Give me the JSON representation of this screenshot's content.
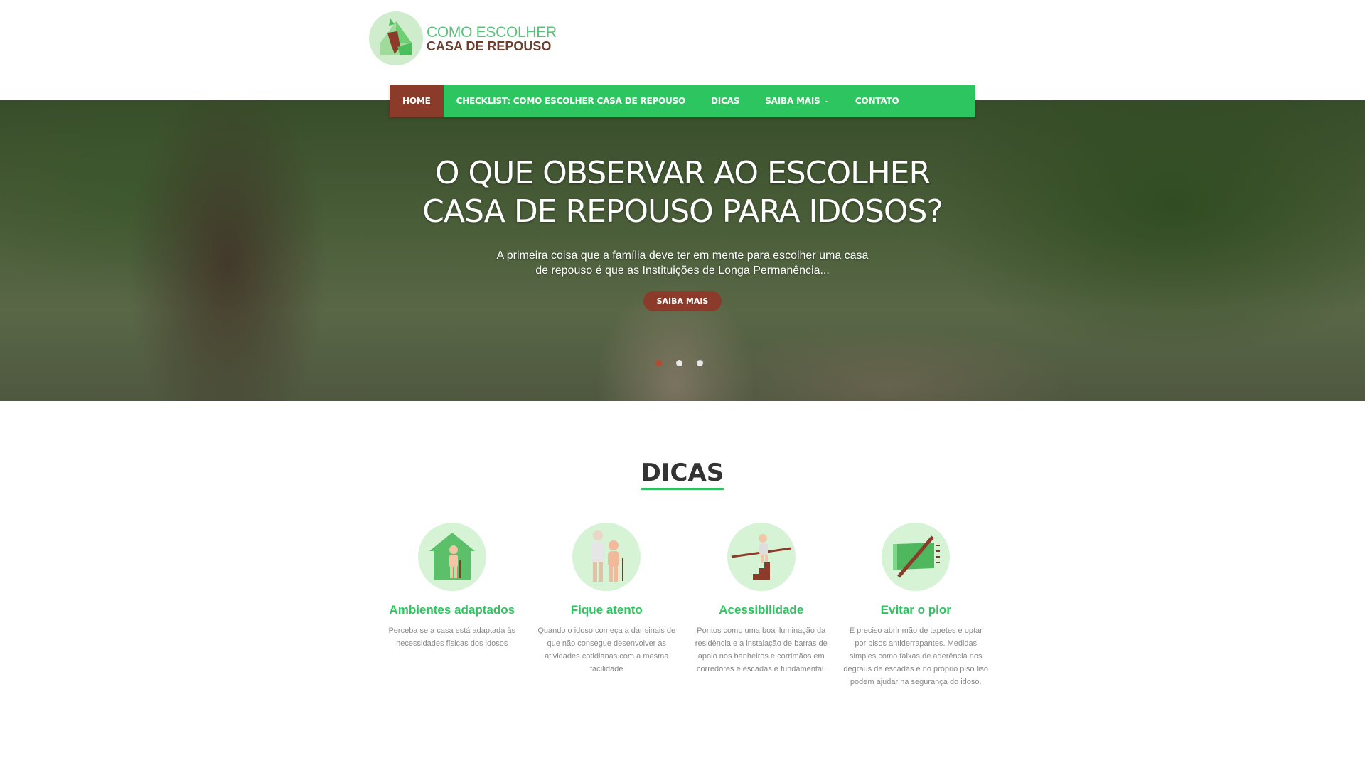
{
  "logo": {
    "line1": "COMO ESCOLHER",
    "line2": "CASA DE REPOUSO"
  },
  "nav": {
    "items": [
      {
        "label": "HOME"
      },
      {
        "label": "CHECKLIST: COMO ESCOLHER CASA DE REPOUSO"
      },
      {
        "label": "DICAS"
      },
      {
        "label": "SAIBA MAIS"
      },
      {
        "label": "CONTATO"
      }
    ]
  },
  "hero": {
    "title": "O QUE OBSERVAR AO ESCOLHER CASA DE REPOUSO PARA IDOSOS?",
    "subtitle": "A primeira coisa que a família deve ter em mente para escolher uma casa de repouso é que as Instituições de Longa Permanência...",
    "button": "SAIBA MAIS",
    "slides_total": 3,
    "active_slide": 1
  },
  "dicas": {
    "title": "DICAS",
    "cards": [
      {
        "icon": "house-elderly-icon",
        "title": "Ambientes adaptados",
        "text": "Perceba se a casa está adaptada às necessidades físicas dos idosos"
      },
      {
        "icon": "elderly-couple-icon",
        "title": "Fique atento",
        "text": "Quando o idoso começa a dar sinais de que não consegue desenvolver as atividades cotidianas com a mesma facilidade"
      },
      {
        "icon": "stairs-handrail-icon",
        "title": "Acessibilidade",
        "text": "Pontos como uma boa iluminação da residência e a instalação de barras de apoio nos banheiros e corrimãos em corredores e escadas é fundamental."
      },
      {
        "icon": "no-rug-icon",
        "title": "Evitar o pior",
        "text": "É preciso abrir mão de tapetes e optar por pisos antiderrapantes. Medidas simples como faixas de aderência nos degraus de escadas e no próprio piso liso podem ajudar na segurança do idoso."
      }
    ]
  },
  "colors": {
    "primary": "#2dc55f",
    "accent": "#8a3b2a",
    "text": "#333333"
  }
}
